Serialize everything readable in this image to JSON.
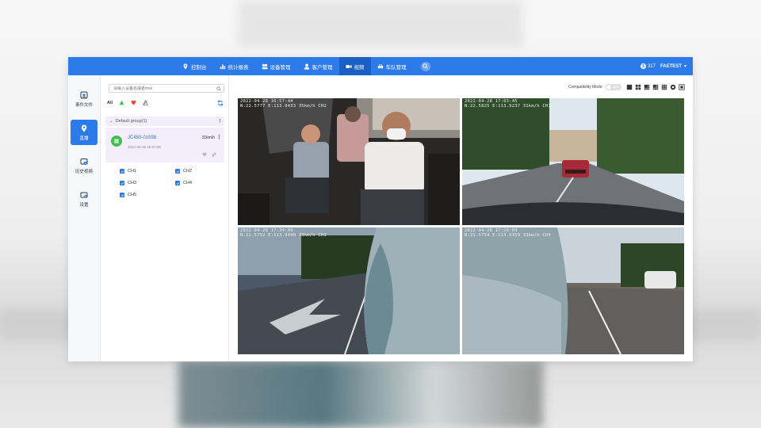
{
  "nav": {
    "items": [
      {
        "label": "控制台",
        "icon": "location-pin-icon"
      },
      {
        "label": "统计报表",
        "icon": "bar-chart-icon"
      },
      {
        "label": "设备管理",
        "icon": "device-group-icon"
      },
      {
        "label": "客户管理",
        "icon": "user-icon"
      },
      {
        "label": "视频",
        "icon": "camera-icon",
        "active": true
      },
      {
        "label": "车队管理",
        "icon": "car-icon"
      }
    ]
  },
  "user": {
    "points": "317",
    "name": "FAETEST"
  },
  "sidebar": {
    "items": [
      {
        "label": "事件文件",
        "icon": "event-file-icon"
      },
      {
        "label": "直播",
        "icon": "live-pin-icon",
        "active": true
      },
      {
        "label": "历史视频",
        "icon": "history-video-icon"
      },
      {
        "label": "设置",
        "icon": "settings-icon"
      }
    ]
  },
  "panel": {
    "search_placeholder": "请输入设备名或者imei",
    "filter_all": "All",
    "group_label": "Default group(1)",
    "device": {
      "name": "JC450-01598",
      "speed": "31km/h",
      "time": "2022-04-28 16:57:38"
    },
    "channels": [
      "CH1",
      "CH2",
      "CH3",
      "CH4",
      "CH5"
    ]
  },
  "toolbar": {
    "compat_label": "Compatibility Mode:",
    "toggle_state": "OFF"
  },
  "videos": [
    {
      "ts": "2022-04-28 16:57:44\nN:22.5777 E:113.9433 35km/h CH2"
    },
    {
      "ts": "2022-04-28 17:03:45\nN:22.5825 E:113.9237 31km/h CH1"
    },
    {
      "ts": "2022-04-28 17:34:09\nN:22.5752 E:113.9440 33km/h CH3"
    },
    {
      "ts": "2022-04-28 17:26:09\nN:22.5754 E:113.9359 33km/h CH4"
    }
  ],
  "colors": {
    "brand": "#2d7bea",
    "online": "#3fbf4f"
  }
}
